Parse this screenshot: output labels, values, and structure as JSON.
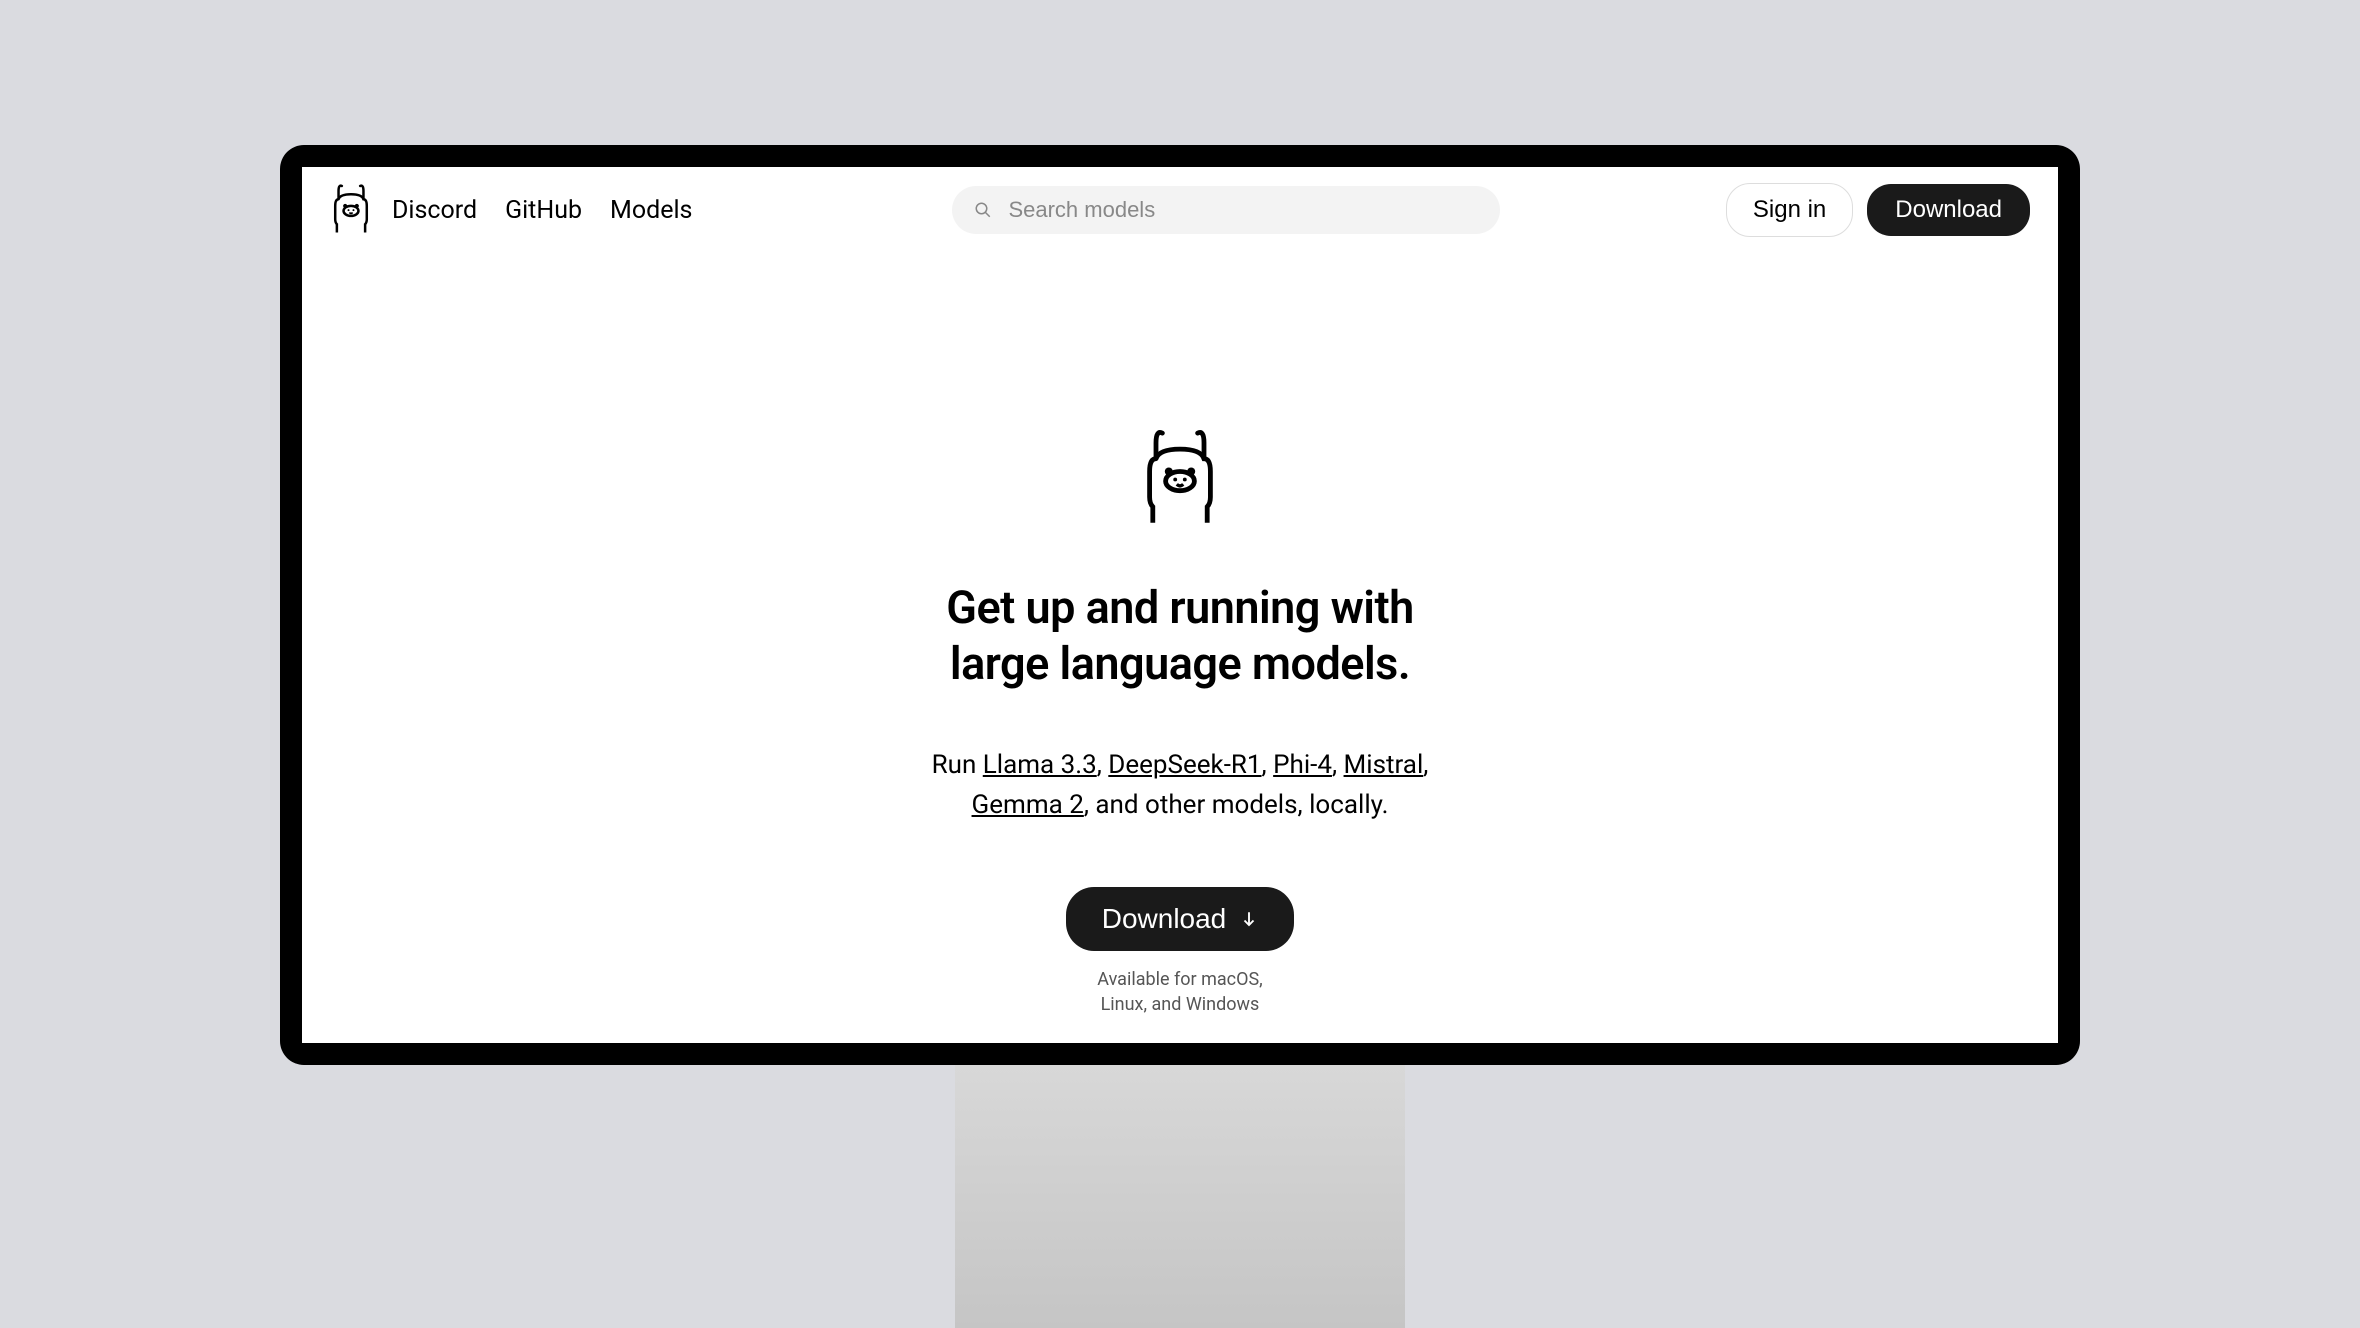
{
  "nav": {
    "links": [
      "Discord",
      "GitHub",
      "Models"
    ]
  },
  "search": {
    "placeholder": "Search models"
  },
  "header": {
    "signin": "Sign in",
    "download": "Download"
  },
  "hero": {
    "title": "Get up and running with large language models.",
    "subtitle_prefix": "Run ",
    "models": [
      "Llama 3.3",
      "DeepSeek-R1",
      "Phi-4",
      "Mistral",
      "Gemma 2"
    ],
    "subtitle_suffix": ", and other models, locally.",
    "download_label": "Download",
    "availability_line1": "Available for macOS,",
    "availability_line2": "Linux, and Windows"
  }
}
